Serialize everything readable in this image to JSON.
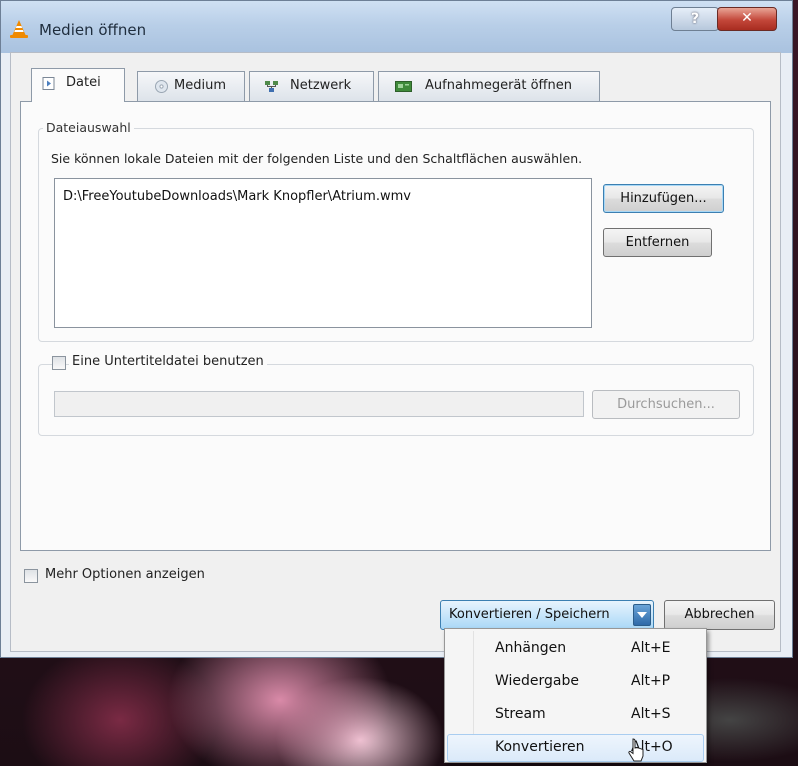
{
  "window": {
    "title": "Medien öffnen",
    "help_label": "?",
    "close_label": "✕"
  },
  "tabs": [
    {
      "label": "Datei",
      "icon": "file-icon",
      "active": true
    },
    {
      "label": "Medium",
      "icon": "disc-icon",
      "active": false
    },
    {
      "label": "Netzwerk",
      "icon": "network-icon",
      "active": false
    },
    {
      "label": "Aufnahmegerät öffnen",
      "icon": "capture-card-icon",
      "active": false
    }
  ],
  "file_selection": {
    "group_title": "Dateiauswahl",
    "info_text": "Sie können lokale Dateien mit der folgenden Liste und den Schaltflächen auswählen.",
    "files": [
      "D:\\FreeYoutubeDownloads\\Mark Knopfler\\Atrium.wmv"
    ],
    "add_button": "Hinzufügen...",
    "remove_button": "Entfernen"
  },
  "subtitle": {
    "checkbox_label": "Eine Untertiteldatei benutzen",
    "checked": false,
    "path_value": "",
    "browse_button": "Durchsuchen..."
  },
  "more_options": {
    "checkbox_label": "Mehr Optionen anzeigen",
    "checked": false
  },
  "actions": {
    "primary_label": "Konvertieren / Speichern",
    "cancel_label": "Abbrechen"
  },
  "dropdown_menu": [
    {
      "label": "Anhängen",
      "shortcut": "Alt+E"
    },
    {
      "label": "Wiedergabe",
      "shortcut": "Alt+P"
    },
    {
      "label": "Stream",
      "shortcut": "Alt+S"
    },
    {
      "label": "Konvertieren",
      "shortcut": "Alt+O",
      "hovered": true
    }
  ],
  "colors": {
    "accent": "#3c7fb1",
    "close_red": "#c3473a",
    "vlc_orange": "#f08a00"
  }
}
